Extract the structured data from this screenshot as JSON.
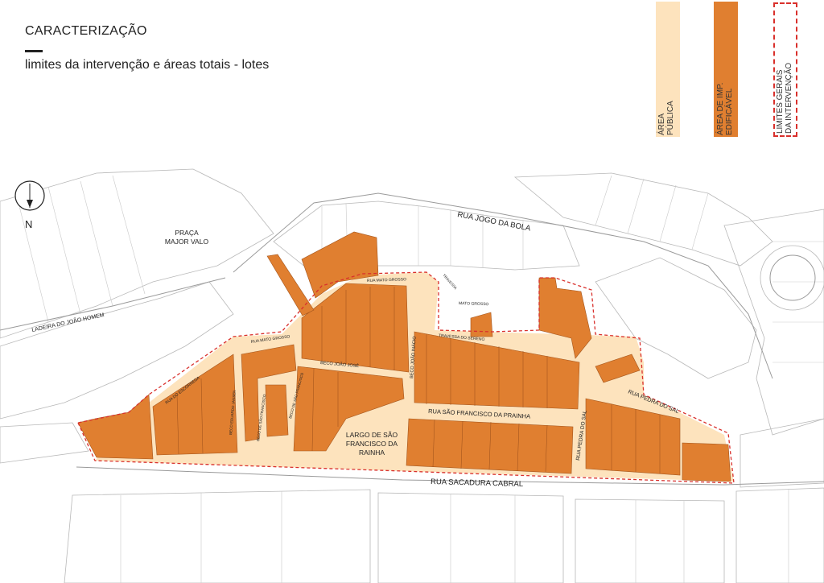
{
  "header": {
    "title": "CARACTERIZAÇÃO",
    "subtitle": "limites da intervenção e áreas totais - lotes"
  },
  "legend": [
    {
      "line1": "ÁREA",
      "line2": "PÚBLICA",
      "color": "#fde3bd"
    },
    {
      "line1": "ÁREA DE IMP.",
      "line2": "EDIFICÁVEL",
      "color": "#e07f30"
    },
    {
      "line1": "LIMITES GERAIS",
      "line2": "DA INTERVENÇÃO",
      "color": "#d9302c"
    }
  ],
  "compass": {
    "label": "N"
  },
  "places": {
    "praca_1": "PRAÇA",
    "praca_2": "MAJOR VALO",
    "largo_1": "LARGO DE SÃO",
    "largo_2": "FRANCISCO DA",
    "largo_3": "RAINHA"
  },
  "streets": {
    "jogo_da_bola": "RUA JOGO DA BOLA",
    "ladeira": "LADEIRA DO JOÃO HOMEM",
    "sacadura": "RUA SACADURA CABRAL",
    "sao_francisco": "RUA SÃO FRANCISCO DA PRAINHA",
    "pedra_do_sal_v": "RUA PEDRA DO SAL",
    "pedra_do_sal_d": "RUA PEDRA DO SAL",
    "beco_joao_inacio": "BECO JOÃO INÁCIO",
    "beco_joao_jose": "BECO JOÃO JOSÉ",
    "mato_grosso_1": "RUA MATO GROSSO",
    "mato_grosso_2": "RUA MATO GROSSO",
    "mato_grosso_3": "MATO GROSSO",
    "travessa_sereno": "TRAVESSA DO SERENO",
    "travessa_small": "TRAVESSA",
    "rua_escorrega": "RUA DO ESCORREGA",
    "beco_eduardo": "BECO EDUARDO JANSEN",
    "beco_sao_francisco_1": "BECO DE SÃO FRANCISCO",
    "beco_sao_francisco_2": "BECO DE SÃO FRANCISCO"
  }
}
